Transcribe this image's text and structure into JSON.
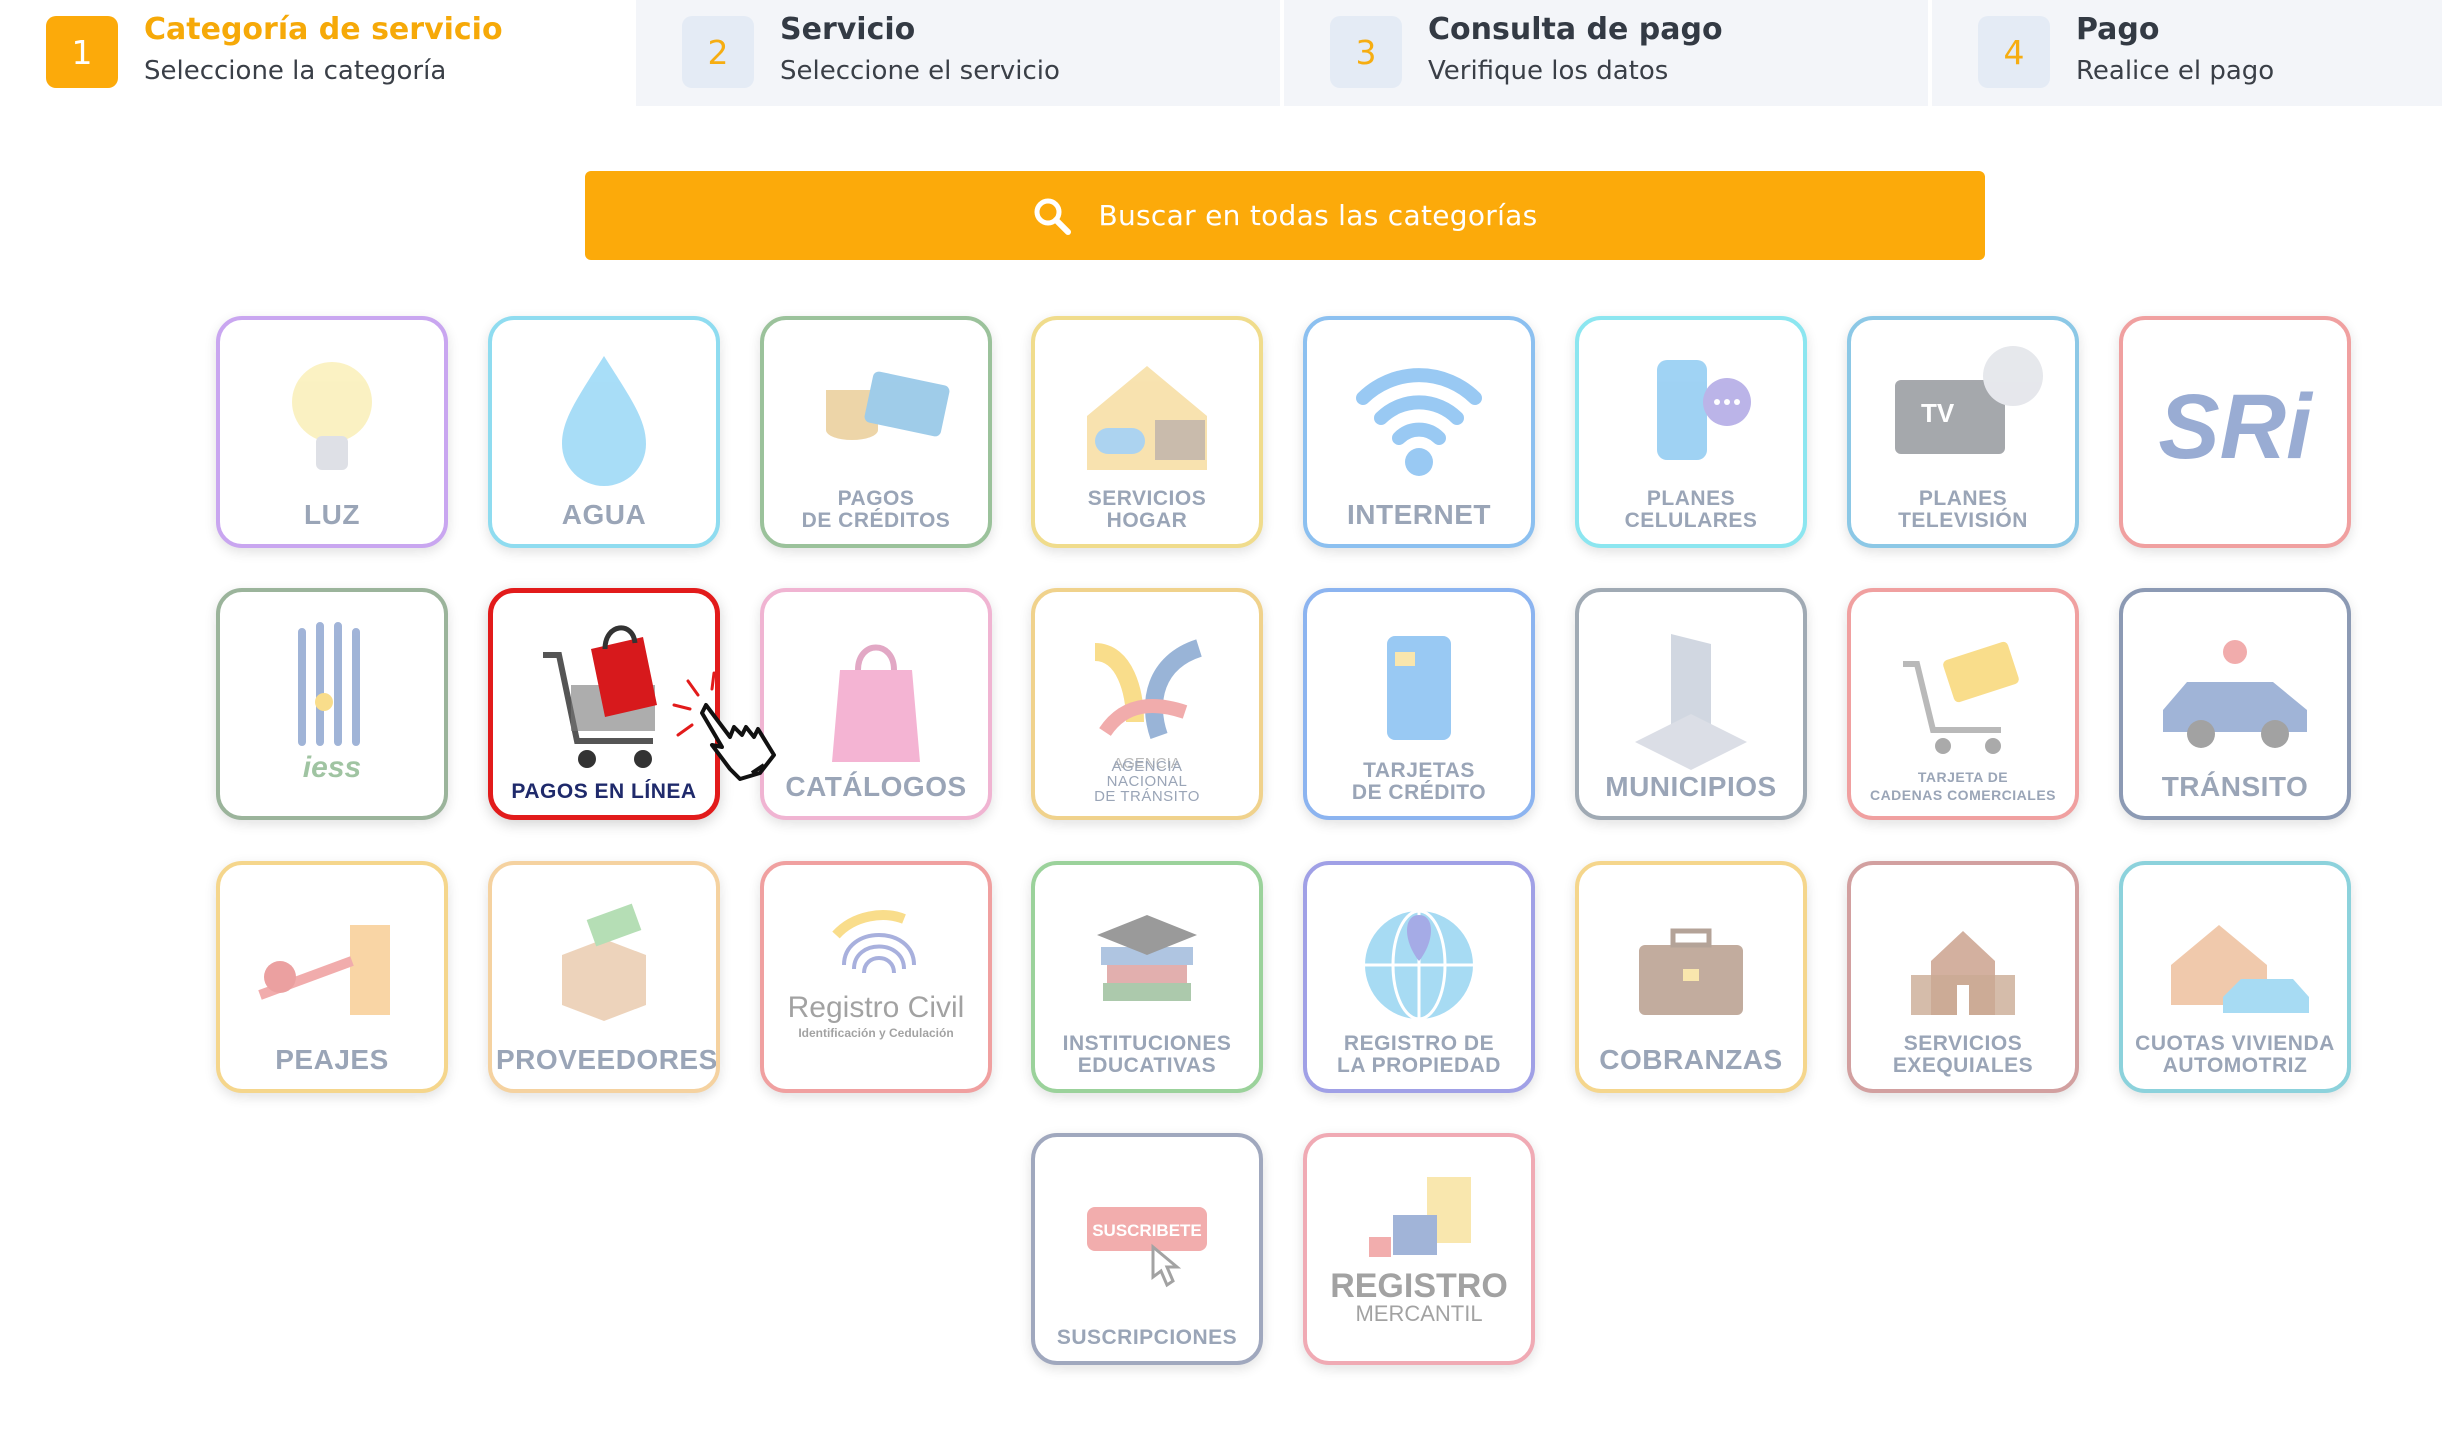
{
  "steps": [
    {
      "num": "1",
      "title": "Categoría de servicio",
      "subtitle": "Seleccione la categoría",
      "active": true
    },
    {
      "num": "2",
      "title": "Servicio",
      "subtitle": "Seleccione el servicio",
      "active": false
    },
    {
      "num": "3",
      "title": "Consulta de pago",
      "subtitle": "Verifique los datos",
      "active": false
    },
    {
      "num": "4",
      "title": "Pago",
      "subtitle": "Realice el pago",
      "active": false
    }
  ],
  "search": {
    "placeholder": "Buscar en todas las categorías",
    "color": "#fcaa0a"
  },
  "categories": [
    {
      "label": "LUZ",
      "icon": "lightbulb-icon",
      "color": "#c9a6f0"
    },
    {
      "label": "AGUA",
      "icon": "water-drop-icon",
      "color": "#8fdcf0"
    },
    {
      "label": "PAGOS\nDE CRÉDITOS",
      "icon": "coins-card-icon",
      "color": "#9bc29b"
    },
    {
      "label": "SERVICIOS\nHOGAR",
      "icon": "house-appliances-icon",
      "color": "#f0dc8c"
    },
    {
      "label": "INTERNET",
      "icon": "wifi-icon",
      "color": "#8cc0f0"
    },
    {
      "label": "PLANES\nCELULARES",
      "icon": "cellphone-icon",
      "color": "#8ce6f0"
    },
    {
      "label": "PLANES\nTELEVISIÓN",
      "icon": "tv-dish-icon",
      "color": "#8cc8e6"
    },
    {
      "label": "",
      "icon": "sri-logo-icon",
      "logo_text": "SRi",
      "color": "#f0a0a0"
    },
    {
      "label": "",
      "icon": "iess-logo-icon",
      "logo_text": "iess",
      "color": "#9bb49b"
    },
    {
      "label": "PAGOS EN LÍNEA",
      "icon": "shopping-cart-icon",
      "color": "#e21b1b",
      "selected": true
    },
    {
      "label": "CATÁLOGOS",
      "icon": "shopping-bag-icon",
      "color": "#f0b4d2"
    },
    {
      "label": "AGENCIA\nNACIONAL\nDE TRÁNSITO",
      "icon": "ant-logo-icon",
      "color": "#f0d28c"
    },
    {
      "label": "TARJETAS\nDE CRÉDITO",
      "icon": "credit-card-icon",
      "color": "#8cb4f0"
    },
    {
      "label": "MUNICIPIOS",
      "icon": "building-icon",
      "color": "#a0aab4"
    },
    {
      "label": "TARJETA DE\nCADENAS COMERCIALES",
      "icon": "cart-card-icon",
      "color": "#f0a0a0"
    },
    {
      "label": "TRÁNSITO",
      "icon": "car-icon",
      "color": "#8c9ab4"
    },
    {
      "label": "PEAJES",
      "icon": "toll-gate-icon",
      "color": "#f5d68c"
    },
    {
      "label": "PROVEEDORES",
      "icon": "box-money-icon",
      "color": "#f5d2a0"
    },
    {
      "label": "",
      "icon": "fingerprint-icon",
      "logo_text": "Registro Civil",
      "logo_sub": "Identificación y Cedulación",
      "color": "#f0a0a0"
    },
    {
      "label": "INSTITUCIONES\nEDUCATIVAS",
      "icon": "books-cap-icon",
      "color": "#9bd29b"
    },
    {
      "label": "REGISTRO DE\nLA PROPIEDAD",
      "icon": "globe-pin-icon",
      "color": "#a0a0e6"
    },
    {
      "label": "COBRANZAS",
      "icon": "briefcase-icon",
      "color": "#f5d68c"
    },
    {
      "label": "SERVICIOS\nEXEQUIALES",
      "icon": "chapel-icon",
      "color": "#d2a0a0"
    },
    {
      "label": "CUOTAS VIVIENDA\nAUTOMOTRIZ",
      "icon": "house-car-icon",
      "color": "#8cd2dc"
    },
    {
      "label": "SUSCRIPCIONES",
      "icon": "subscribe-button-icon",
      "badge": "SUSCRIBETE",
      "color": "#a0a8be"
    },
    {
      "label": "",
      "icon": "registro-mercantil-logo-icon",
      "logo_text": "REGISTRO",
      "logo_sub": "MERCANTIL",
      "color": "#f0aab4"
    }
  ]
}
